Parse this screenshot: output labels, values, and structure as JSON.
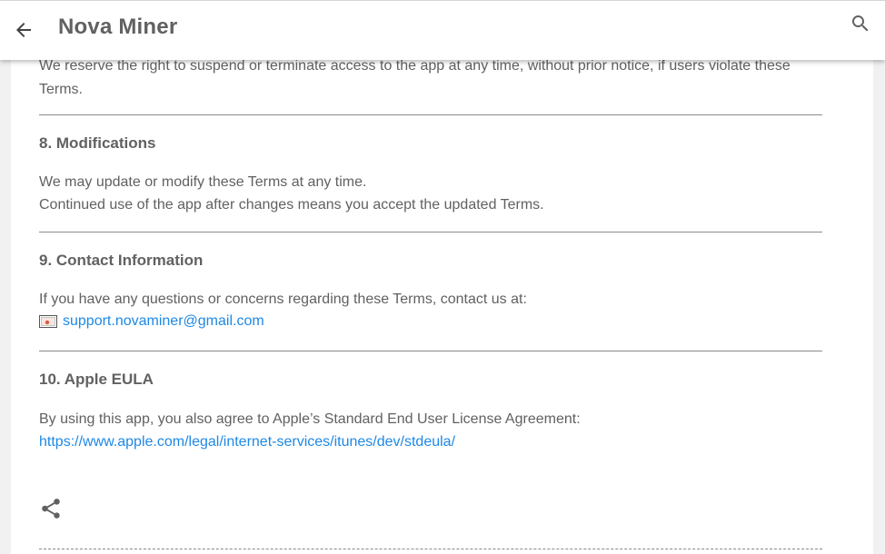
{
  "appbar": {
    "title": "Nova Miner",
    "back_icon": "arrow-back-icon",
    "search_icon": "search-icon"
  },
  "section7": {
    "line1": "We reserve the right to suspend or terminate access to the app at any time, without prior notice, if users violate these",
    "line2": "Terms."
  },
  "section8": {
    "heading": "8. Modifications",
    "line1": "We may update or modify these Terms at any time.",
    "line2": "Continued use of the app after changes means you accept the updated Terms."
  },
  "section9": {
    "heading": "9. Contact Information",
    "line1": "If you have any questions or concerns regarding these Terms, contact us at:",
    "email": "support.novaminer@gmail.com",
    "email_icon": "envelope-icon"
  },
  "section10": {
    "heading": "10. Apple EULA",
    "line1": "By using this app, you also agree to Apple’s Standard End User License Agreement:",
    "link": "https://www.apple.com/legal/internet-services/itunes/dev/stdeula/"
  },
  "footer": {
    "share_icon": "share-icon"
  },
  "colors": {
    "text": "#616161",
    "link": "#1e88e5",
    "background": "#f1f1f1",
    "card": "#ffffff"
  }
}
